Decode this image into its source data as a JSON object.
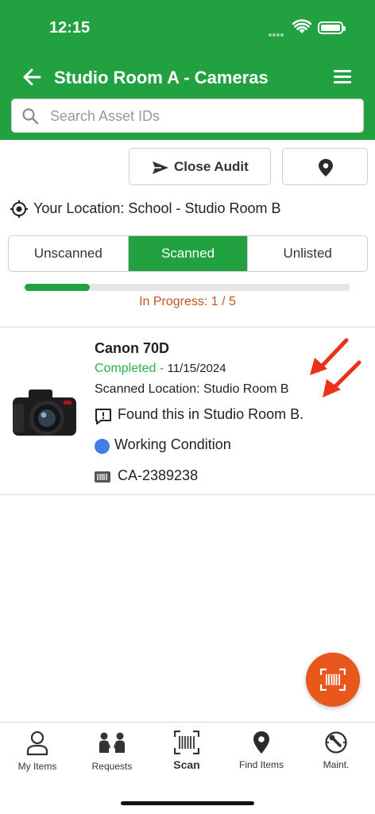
{
  "status_bar": {
    "time": "12:15"
  },
  "header": {
    "title": "Studio Room A - Cameras"
  },
  "search": {
    "placeholder": "Search Asset IDs",
    "value": ""
  },
  "actions": {
    "close_audit": "Close Audit"
  },
  "location": {
    "text": "Your Location: School - Studio Room B"
  },
  "tabs": [
    {
      "label": "Unscanned",
      "active": false
    },
    {
      "label": "Scanned",
      "active": true
    },
    {
      "label": "Unlisted",
      "active": false
    }
  ],
  "progress": {
    "text": "In Progress: 1 / 5",
    "fraction": 0.2
  },
  "item": {
    "name": "Canon 70D",
    "status": "Completed -",
    "date": "11/15/2024",
    "scanned_location": "Scanned Location: Studio Room B",
    "note": "Found this in Studio Room B.",
    "condition": "Working Condition",
    "asset_id": "CA-2389238"
  },
  "bottom_nav": [
    {
      "label": "My Items",
      "icon": "person-icon"
    },
    {
      "label": "Requests",
      "icon": "requests-icon"
    },
    {
      "label": "Scan",
      "icon": "barcode-icon",
      "active": true
    },
    {
      "label": "Find Items",
      "icon": "map-pin-icon"
    },
    {
      "label": "Maint.",
      "icon": "maintenance-icon"
    }
  ],
  "colors": {
    "brand_green": "#22a140",
    "accent_orange": "#e8571b",
    "completed_green": "#2bb24c",
    "progress_text": "#c5531a",
    "annotation_red": "#e8321a",
    "condition_blue": "#3f7fe6"
  }
}
